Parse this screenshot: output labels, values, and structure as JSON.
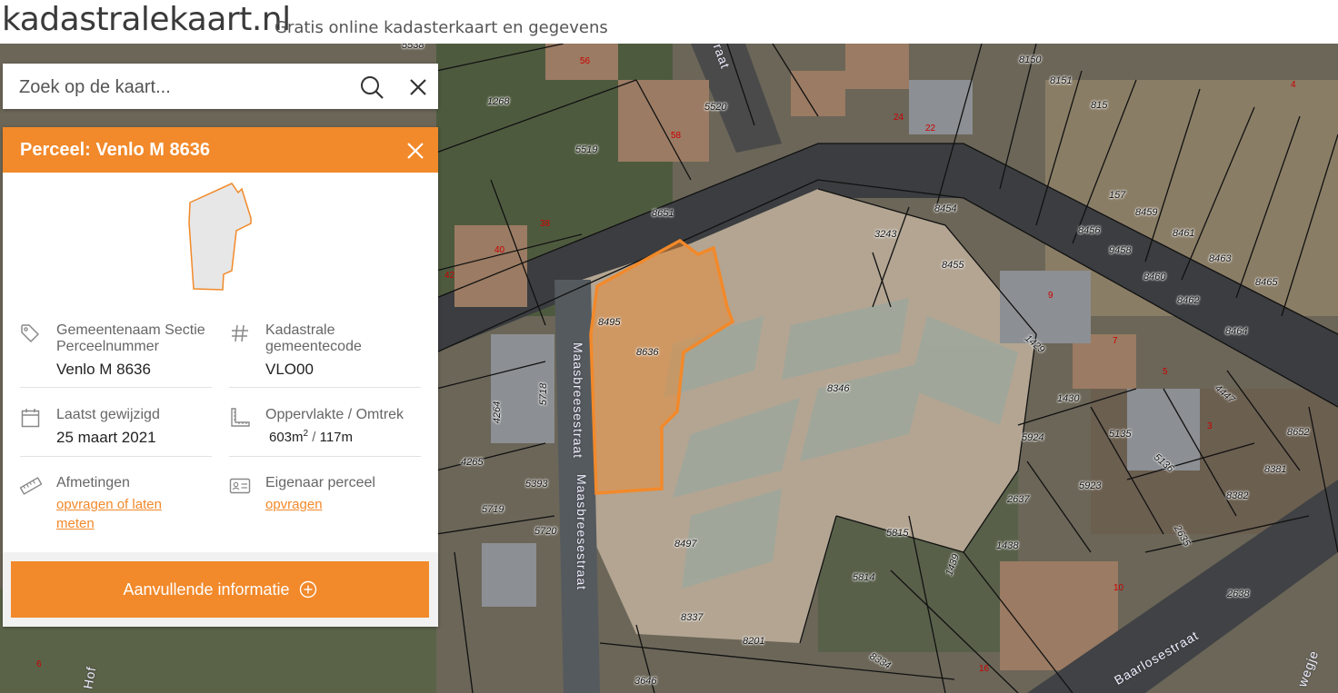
{
  "header": {
    "logo": "kadastralekaart.nl",
    "tagline": "Gratis online kadasterkaart en gegevens"
  },
  "search": {
    "placeholder": "Zoek op de kaart..."
  },
  "panel": {
    "title": "Perceel: Venlo M 8636",
    "fields": {
      "gemeente_label": "Gemeentenaam Sectie Perceelnummer",
      "gemeente_value": "Venlo M 8636",
      "code_label": "Kadastrale gemeentecode",
      "code_value": "VLO00",
      "gewijzigd_label": "Laatst gewijzigd",
      "gewijzigd_value": "25 maart 2021",
      "opp_label": "Oppervlakte / Omtrek",
      "opp_area": "603m",
      "opp_sup": "2",
      "opp_sep": " / ",
      "opp_perimeter": "117m",
      "afmetingen_label": "Afmetingen",
      "afmetingen_link": "opvragen of laten meten",
      "eigenaar_label": "Eigenaar perceel",
      "eigenaar_link": "opvragen"
    },
    "button_label": "Aanvullende informatie"
  },
  "colors": {
    "accent": "#f2892a",
    "parcel_fill": "#e7e7e7",
    "parcel_stroke": "#f2892a"
  },
  "icons": [
    "search-icon",
    "close-icon",
    "tag-icon",
    "hash-icon",
    "calendar-icon",
    "area-icon",
    "ruler-icon",
    "id-card-icon",
    "plus-circle-icon"
  ],
  "map": {
    "parcel_numbers": [
      "5538",
      "1268",
      "5520",
      "5519",
      "8651",
      "8150",
      "8151",
      "815",
      "157",
      "8459",
      "8461",
      "8463",
      "8465",
      "8464",
      "8462",
      "8460",
      "9458",
      "8456",
      "8454",
      "3243",
      "8455",
      "1429",
      "8495",
      "8636",
      "8346",
      "5718",
      "4264",
      "4265",
      "5393",
      "5719",
      "5720",
      "8497",
      "1430",
      "5924",
      "5135",
      "5136",
      "5923",
      "2637",
      "5815",
      "1438",
      "5814",
      "1439",
      "8381",
      "8382",
      "8652",
      "2635",
      "2638",
      "8337",
      "8201",
      "8334",
      "3646",
      "4447"
    ],
    "house_numbers": [
      "56",
      "58",
      "24",
      "22",
      "38",
      "40",
      "42",
      "9",
      "7",
      "5",
      "3",
      "10",
      "16",
      "6",
      "4"
    ],
    "streets": [
      "Maasbreesestraat",
      "Baarlosestraat",
      "Hof",
      "wegje",
      "raat"
    ]
  }
}
